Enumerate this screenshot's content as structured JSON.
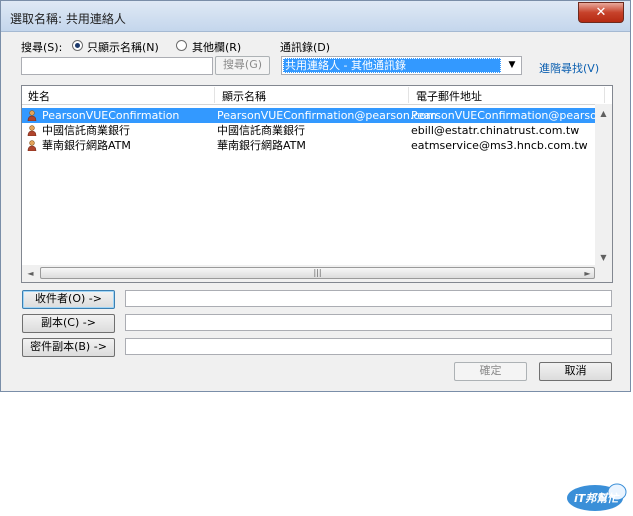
{
  "window": {
    "title": "選取名稱: 共用連絡人",
    "close_glyph": "✕"
  },
  "search": {
    "label": "搜尋(S):",
    "radio_name_only": "只顯示名稱(N)",
    "radio_more_columns": "其他欄(R)",
    "selected": "name_only",
    "query_value": "",
    "go_button": "搜尋(G)"
  },
  "address_book": {
    "label": "通訊錄(D)",
    "selected": "共用連絡人 - 其他通訊錄",
    "advanced_link": "進階尋找(V)"
  },
  "contacts": {
    "columns": [
      "姓名",
      "顯示名稱",
      "電子郵件地址"
    ],
    "rows": [
      {
        "name": "PearsonVUEConfirmation",
        "display": "PearsonVUEConfirmation@pearson.com",
        "email": "PearsonVUEConfirmation@pearson.com",
        "selected": true
      },
      {
        "name": "中國信託商業銀行",
        "display": "中國信託商業銀行",
        "email": "ebill@estatr.chinatrust.com.tw",
        "selected": false
      },
      {
        "name": "華南銀行網路ATM",
        "display": "華南銀行網路ATM",
        "email": "eatmservice@ms3.hncb.com.tw",
        "selected": false
      }
    ]
  },
  "recipients": {
    "to_button": "收件者(O) ->",
    "cc_button": "副本(C) ->",
    "bcc_button": "密件副本(B) ->",
    "to_value": "",
    "cc_value": "",
    "bcc_value": ""
  },
  "footer": {
    "ok_button": "確定",
    "cancel_button": "取消"
  },
  "watermark": {
    "text": "iT邦幫忙"
  },
  "colors": {
    "selection": "#3399ff",
    "link": "#0b5fb0",
    "close": "#c7422b"
  }
}
